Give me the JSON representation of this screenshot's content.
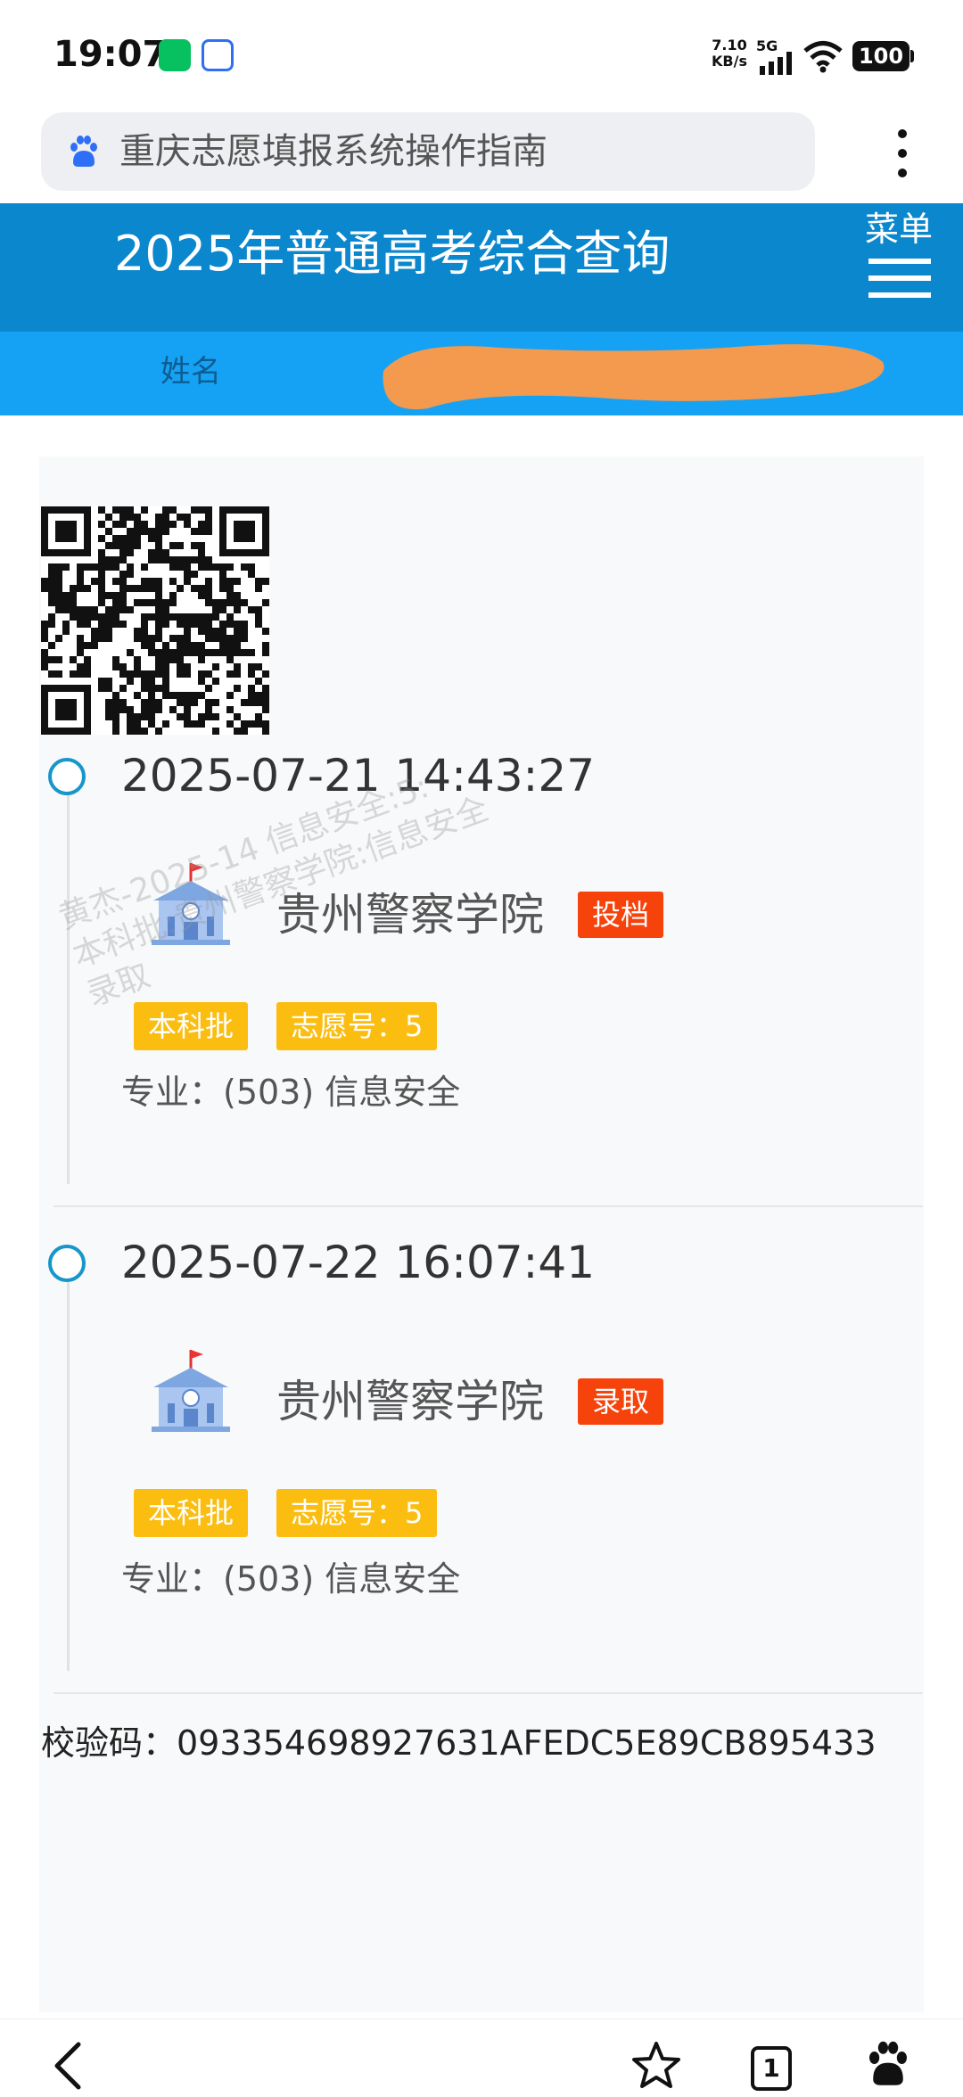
{
  "status_bar": {
    "time": "19:07",
    "net_speed": "7.10\nKB/s",
    "signal_label": "5G",
    "battery": "100",
    "icons": [
      "wechat-icon",
      "baidu-app-icon",
      "signal-icon",
      "wifi-icon",
      "battery-icon"
    ]
  },
  "browser": {
    "address_text": "重庆志愿填报系统操作指南",
    "icons": [
      "baidu-paw-icon",
      "more-vertical-icon"
    ],
    "nav": {
      "tab_count": "1",
      "icons": [
        "back-arrow-icon",
        "star-icon",
        "tabs-icon",
        "baidu-paw-icon"
      ]
    }
  },
  "header": {
    "title": "2025年普通高考综合查询",
    "menu_label": "菜单",
    "sub_header_text": "姓名"
  },
  "entries": [
    {
      "time": "2025-07-21 14:43:27",
      "school": "贵州警察学院",
      "status": "投档",
      "batch": "本科批",
      "choice": "志愿号：5",
      "major": "专业：(503) 信息安全"
    },
    {
      "time": "2025-07-22 16:07:41",
      "school": "贵州警察学院",
      "status": "录取",
      "batch": "本科批",
      "choice": "志愿号：5",
      "major": "专业：(503) 信息安全"
    }
  ],
  "watermark": "黄杰-2025-14 信息安全:5:\n本科批:贵州警察学院:信息安全\n录取",
  "checksum": "校验码：093354698927631AFEDC5E89CB895433",
  "colors": {
    "header_bg": "#0b87cd",
    "sub_header_bg": "#16a2f4",
    "status_tag": "#f6420b",
    "info_tag": "#fbbd10",
    "timeline_dot": "#1796c9"
  }
}
